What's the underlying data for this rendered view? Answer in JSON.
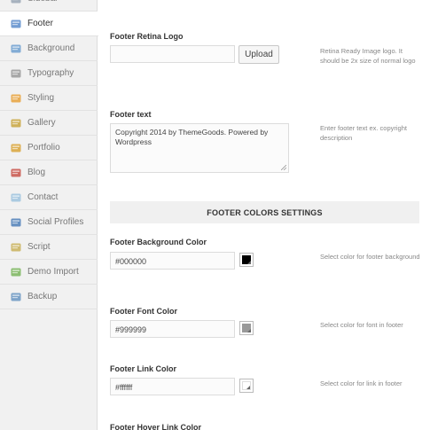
{
  "sidebar": {
    "items": [
      {
        "label": "Sidebar",
        "icon": "sidebar-icon",
        "color": "#9aa7b5",
        "active": false
      },
      {
        "label": "Footer",
        "icon": "footer-icon",
        "color": "#5b8ccb",
        "active": true
      },
      {
        "label": "Background",
        "icon": "background-icon",
        "color": "#6fa0d0",
        "active": false
      },
      {
        "label": "Typography",
        "icon": "typography-icon",
        "color": "#9a9a9a",
        "active": false
      },
      {
        "label": "Styling",
        "icon": "styling-icon",
        "color": "#e8a23c",
        "active": false
      },
      {
        "label": "Gallery",
        "icon": "gallery-icon",
        "color": "#c9a640",
        "active": false
      },
      {
        "label": "Portfolio",
        "icon": "portfolio-icon",
        "color": "#d9a43a",
        "active": false
      },
      {
        "label": "Blog",
        "icon": "blog-icon",
        "color": "#c8544a",
        "active": false
      },
      {
        "label": "Contact",
        "icon": "contact-icon",
        "color": "#9fc3de",
        "active": false
      },
      {
        "label": "Social Profiles",
        "icon": "social-profiles-icon",
        "color": "#4d7fb8",
        "active": false
      },
      {
        "label": "Script",
        "icon": "script-icon",
        "color": "#c9b25c",
        "active": false
      },
      {
        "label": "Demo Import",
        "icon": "demo-import-icon",
        "color": "#7ab55c",
        "active": false
      },
      {
        "label": "Backup",
        "icon": "backup-icon",
        "color": "#6a97c2",
        "active": false
      }
    ]
  },
  "main": {
    "retina_logo": {
      "label": "Footer Retina Logo",
      "value": "",
      "button": "Upload",
      "description": "Retina Ready Image logo. It should be 2x size of normal logo"
    },
    "footer_text": {
      "label": "Footer text",
      "value": "Copyright 2014 by ThemeGoods. Powered by Wordpress",
      "description": "Enter footer text ex. copyright description"
    },
    "section_title": "FOOTER COLORS SETTINGS",
    "bg_color": {
      "label": "Footer Background Color",
      "value": "#000000",
      "swatch": "#000000",
      "description": "Select color for footer background"
    },
    "font_color": {
      "label": "Footer Font Color",
      "value": "#999999",
      "swatch": "#999999",
      "description": "Select color for font in footer"
    },
    "link_color": {
      "label": "Footer Link Color",
      "value": "#ffffff",
      "swatch": "#ffffff",
      "description": "Select color for link in footer"
    },
    "hover_link_color": {
      "label": "Footer Hover Link Color"
    }
  }
}
